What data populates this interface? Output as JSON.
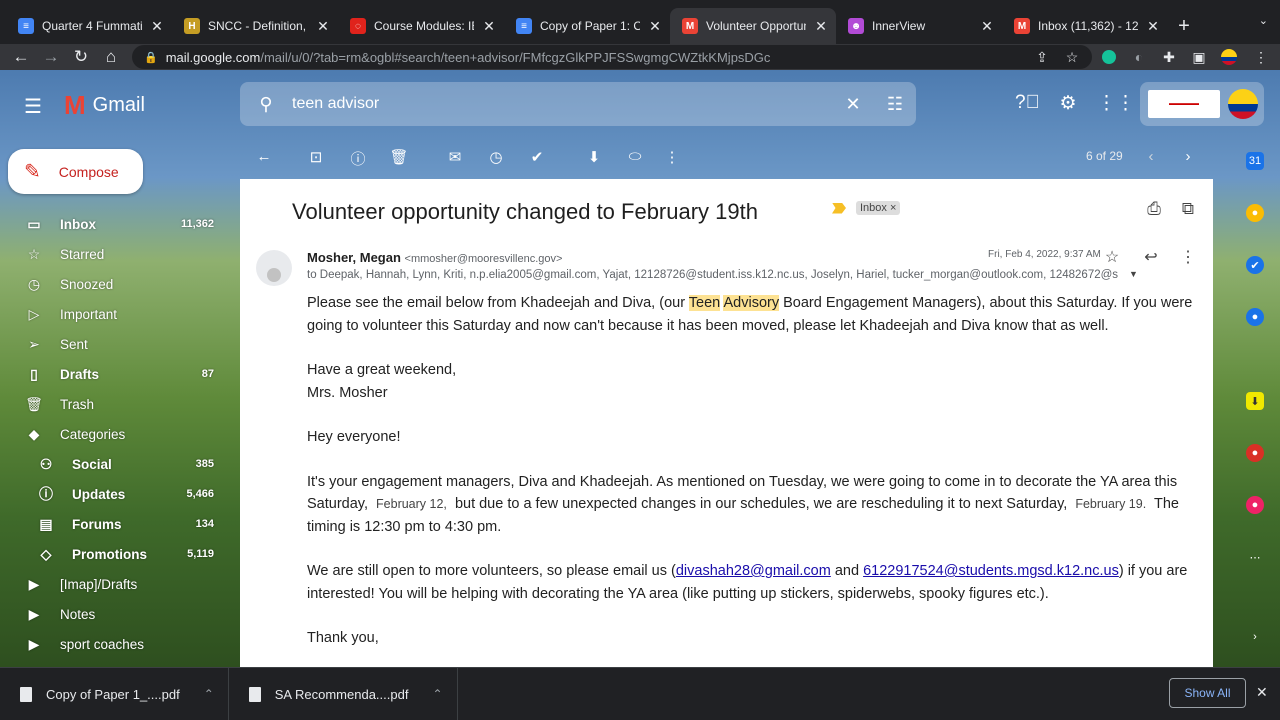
{
  "browser": {
    "tabs": [
      {
        "label": "Quarter 4 Fummativ",
        "favicon": "docs-icon",
        "color": "#4285f4",
        "glyph": "≡"
      },
      {
        "label": "SNCC - Definition, C",
        "favicon": "history-h-icon",
        "color": "#c59d24",
        "glyph": "H"
      },
      {
        "label": "Course Modules: IB",
        "favicon": "canvas-icon",
        "color": "#e0231c",
        "glyph": "◌"
      },
      {
        "label": "Copy of Paper 1: Or",
        "favicon": "docs-icon",
        "color": "#4285f4",
        "glyph": "≡"
      },
      {
        "label": "Volunteer Opportun",
        "favicon": "gmail-icon",
        "color": "#ea4335",
        "glyph": "M",
        "active": true
      },
      {
        "label": "InnerView",
        "favicon": "innerview-icon",
        "color": "#b24bd6",
        "glyph": "☻"
      },
      {
        "label": "Inbox (11,362) - 122",
        "favicon": "gmail-icon",
        "color": "#ea4335",
        "glyph": "M"
      }
    ],
    "url_host": "mail.google.com",
    "url_path": "/mail/u/0/?tab=rm&ogbl#search/teen+advisor/FMfcgzGlkPPJFSSwgmgCWZtkKMjpsDGc"
  },
  "gmail": {
    "app_name": "Gmail",
    "search_query": "teen advisor",
    "compose_label": "Compose",
    "pager": "6 of 29",
    "sidebar": [
      {
        "label": "Inbox",
        "count": "11,362",
        "icon": "inbox-icon",
        "glyph": "▭",
        "bold": true
      },
      {
        "label": "Starred",
        "count": "",
        "icon": "star-icon",
        "glyph": "☆"
      },
      {
        "label": "Snoozed",
        "count": "",
        "icon": "clock-icon",
        "glyph": "◷"
      },
      {
        "label": "Important",
        "count": "",
        "icon": "important-icon",
        "glyph": "▷"
      },
      {
        "label": "Sent",
        "count": "",
        "icon": "send-icon",
        "glyph": "➢"
      },
      {
        "label": "Drafts",
        "count": "87",
        "icon": "draft-icon",
        "glyph": "▯",
        "bold": true
      },
      {
        "label": "Trash",
        "count": "",
        "icon": "trash-icon",
        "glyph": "🗑"
      },
      {
        "label": "Categories",
        "count": "",
        "icon": "label-icon",
        "glyph": "◆"
      },
      {
        "label": "Social",
        "count": "385",
        "icon": "people-icon",
        "glyph": "⚇",
        "bold": true,
        "sub": true
      },
      {
        "label": "Updates",
        "count": "5,466",
        "icon": "info-icon",
        "glyph": "ⓘ",
        "bold": true,
        "sub": true
      },
      {
        "label": "Forums",
        "count": "134",
        "icon": "forum-icon",
        "glyph": "▤",
        "bold": true,
        "sub": true
      },
      {
        "label": "Promotions",
        "count": "5,119",
        "icon": "tag-icon",
        "glyph": "◇",
        "bold": true,
        "sub": true
      },
      {
        "label": "[Imap]/Drafts",
        "count": "",
        "icon": "label-icon",
        "glyph": "▶"
      },
      {
        "label": "Notes",
        "count": "",
        "icon": "label-icon",
        "glyph": "▶"
      },
      {
        "label": "sport coaches",
        "count": "",
        "icon": "label-icon",
        "glyph": "▶"
      }
    ]
  },
  "email": {
    "subject": "Volunteer opportunity changed to February 19th",
    "label_chip": "Inbox",
    "sender_name": "Mosher, Megan",
    "sender_email": "<mmosher@mooresvillenc.gov>",
    "to_line": "to Deepak, Hannah, Lynn, Kriti, n.p.elia2005@gmail.com, Yajat, 12128726@student.iss.k12.nc.us, Joselyn, Hariel, tucker_morgan@outlook.com, 12482672@s",
    "date": "Fri, Feb 4, 2022, 9:37 AM",
    "p1_a": "Please see the email below from Khadeejah and Diva, (our ",
    "hl1": "Teen",
    "hl2": "Advisory",
    "p1_b": " Board Engagement Managers), about this Saturday. If you were going to volunteer this Saturday and now can't because it has been moved, please let Khadeejah and Diva know that as well.",
    "sign1": "Have a great weekend,",
    "sign2": "Mrs. Mosher",
    "greet": "Hey everyone!",
    "p2_a": "It's your engagement managers, Diva and Khadeejah. As mentioned on Tuesday, we were going to come in to decorate the YA area this Saturday,",
    "date1": "February 12,",
    "p2_b": "but due to a few unexpected changes in our schedules, we are rescheduling it to next Saturday,",
    "date2": "February 19.",
    "p2_c": "The timing is 12:30 pm to 4:30 pm.",
    "p3_a": "We are still open to more volunteers, so please email us  (",
    "link1": "divashah28@gmail.com",
    "p3_b": " and ",
    "link2": "6122917524@students.mgsd.k12.nc.us",
    "p3_c": ") if you are interested! You will be helping with decorating the YA area (like putting up stickers, spiderwebs, spooky figures etc.).",
    "closing": "Thank you,"
  },
  "downloads": {
    "items": [
      "Copy of Paper 1_....pdf",
      "SA Recommenda....pdf"
    ],
    "show_all": "Show All"
  }
}
